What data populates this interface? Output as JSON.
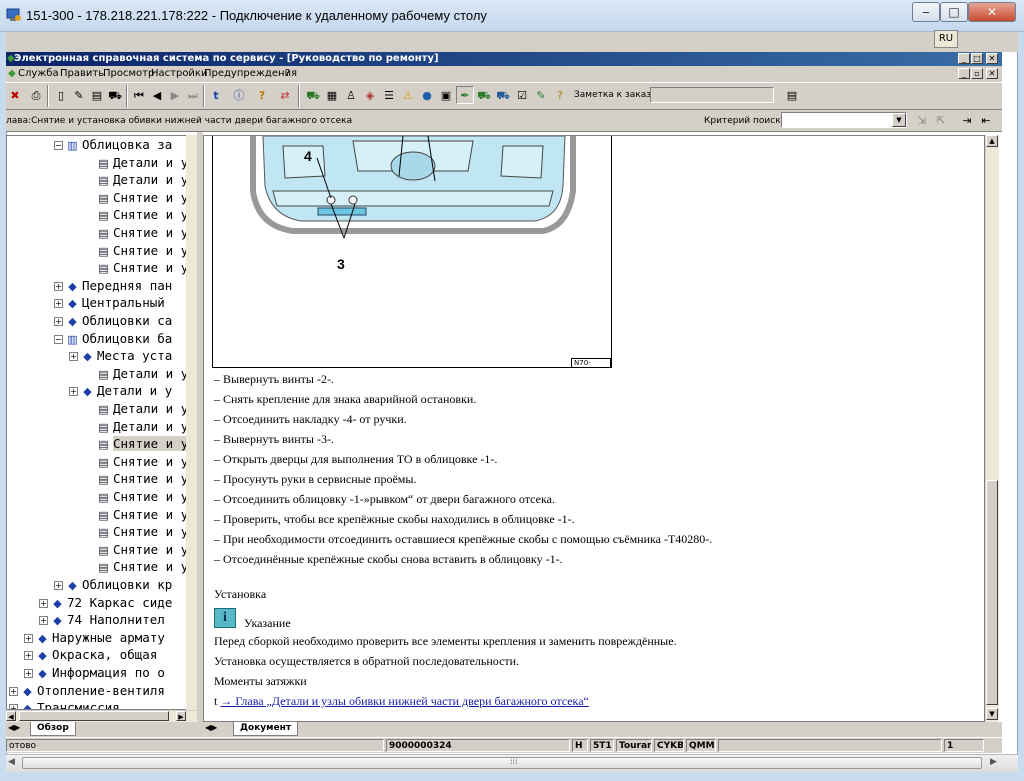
{
  "rdp": {
    "title": "151-300 - 178.218.221.178:222 - Подключение к удаленному рабочему столу",
    "lang": "RU"
  },
  "app": {
    "title": "Электронная справочная система по сервису - [Руководство по ремонту]",
    "menu": [
      "Служба",
      "Править",
      "Просмотр",
      "Настройки",
      "Предупреждения",
      "?"
    ],
    "order_label": "Заметка к заказу:",
    "order_value": "",
    "breadcrumb": "лава:Снятие и установка обивки нижней части двери багажного отсека",
    "criteria_label": "Критерий поиска:",
    "criteria_value": ""
  },
  "tree": [
    {
      "label": "Облицовка за",
      "indent": 3,
      "exp": "−",
      "icon": "open-book"
    },
    {
      "label": "Детали и у",
      "indent": 5,
      "icon": "doc"
    },
    {
      "label": "Детали и у",
      "indent": 5,
      "icon": "doc"
    },
    {
      "label": "Снятие и у",
      "indent": 5,
      "icon": "doc"
    },
    {
      "label": "Снятие и у",
      "indent": 5,
      "icon": "doc"
    },
    {
      "label": "Снятие и у",
      "indent": 5,
      "icon": "doc"
    },
    {
      "label": "Снятие и у",
      "indent": 5,
      "icon": "doc"
    },
    {
      "label": "Снятие и у",
      "indent": 5,
      "icon": "doc"
    },
    {
      "label": "Передняя пан",
      "indent": 3,
      "exp": "+",
      "icon": "book"
    },
    {
      "label": "Центральный",
      "indent": 3,
      "exp": "+",
      "icon": "book"
    },
    {
      "label": "Облицовки са",
      "indent": 3,
      "exp": "+",
      "icon": "book"
    },
    {
      "label": "Облицовки ба",
      "indent": 3,
      "exp": "−",
      "icon": "open-book"
    },
    {
      "label": "Места уста",
      "indent": 4,
      "exp": "+",
      "icon": "book"
    },
    {
      "label": "Детали и у",
      "indent": 5,
      "icon": "doc"
    },
    {
      "label": "Детали и у",
      "indent": 4,
      "exp": "+",
      "icon": "book"
    },
    {
      "label": "Детали и у",
      "indent": 5,
      "icon": "doc"
    },
    {
      "label": "Детали и у",
      "indent": 5,
      "icon": "doc"
    },
    {
      "label": "Снятие и у",
      "indent": 5,
      "icon": "doc",
      "selected": true
    },
    {
      "label": "Снятие и у",
      "indent": 5,
      "icon": "doc"
    },
    {
      "label": "Снятие и у",
      "indent": 5,
      "icon": "doc"
    },
    {
      "label": "Снятие и у",
      "indent": 5,
      "icon": "doc"
    },
    {
      "label": "Снятие и у",
      "indent": 5,
      "icon": "doc"
    },
    {
      "label": "Снятие и у",
      "indent": 5,
      "icon": "doc"
    },
    {
      "label": "Снятие и у",
      "indent": 5,
      "icon": "doc"
    },
    {
      "label": "Снятие и у",
      "indent": 5,
      "icon": "doc"
    },
    {
      "label": "Облицовки кр",
      "indent": 3,
      "exp": "+",
      "icon": "book"
    },
    {
      "label": "72 Каркас сиде",
      "indent": 2,
      "exp": "+",
      "icon": "book"
    },
    {
      "label": "74 Наполнител",
      "indent": 2,
      "exp": "+",
      "icon": "book"
    },
    {
      "label": "Наружные армату",
      "indent": 1,
      "exp": "+",
      "icon": "book"
    },
    {
      "label": "Окраска, общая",
      "indent": 1,
      "exp": "+",
      "icon": "book"
    },
    {
      "label": "Информация по о",
      "indent": 1,
      "exp": "+",
      "icon": "book"
    },
    {
      "label": "Отопление-вентиля",
      "indent": 0,
      "exp": "+",
      "icon": "book"
    },
    {
      "label": "Трансмиссия",
      "indent": 0,
      "exp": "+",
      "icon": "book"
    }
  ],
  "figure": {
    "callout_4": "4",
    "callout_3": "3",
    "code": "N70-11297"
  },
  "steps": [
    "–  Вывернуть винты -2-.",
    "–  Снять крепление для знака аварийной остановки.",
    "–  Отсоединить накладку -4- от ручки.",
    "–  Вывернуть винты -3-.",
    "–  Открыть дверцы для выполнения ТО в облицовке -1-.",
    "–  Просунуть руки в сервисные проёмы.",
    "–  Отсоединить облицовку -1-»рывком“ от двери багажного отсека.",
    "–  Проверить, чтобы все крепёжные скобы находились в облицовке -1-.",
    "–  При необходимости отсоединить оставшиеся крепёжные скобы с помощью съёмника -T40280-.",
    "–  Отсоединённые крепёжные скобы снова вставить в облицовку -1-."
  ],
  "install": {
    "heading": "Установка",
    "note_label": "Указание",
    "note_text": "Перед сборкой необходимо проверить все элементы крепления и заменить повреждённые.",
    "reverse_text": "Установка осуществляется в обратной последовательности.",
    "torque_heading": "Моменты затяжки",
    "link_prefix": "t",
    "link_text": "→ Глава „Детали и узлы обивки нижней части двери багажного отсека“"
  },
  "tabs": {
    "left": "Обзор",
    "right": "Документ"
  },
  "status": {
    "ready": "отово",
    "doc_no": "9000000324",
    "f1": "H",
    "f2": "5T1",
    "f3": "Touran",
    "f4": "CYKB",
    "f5": "QMM",
    "page": "1"
  }
}
